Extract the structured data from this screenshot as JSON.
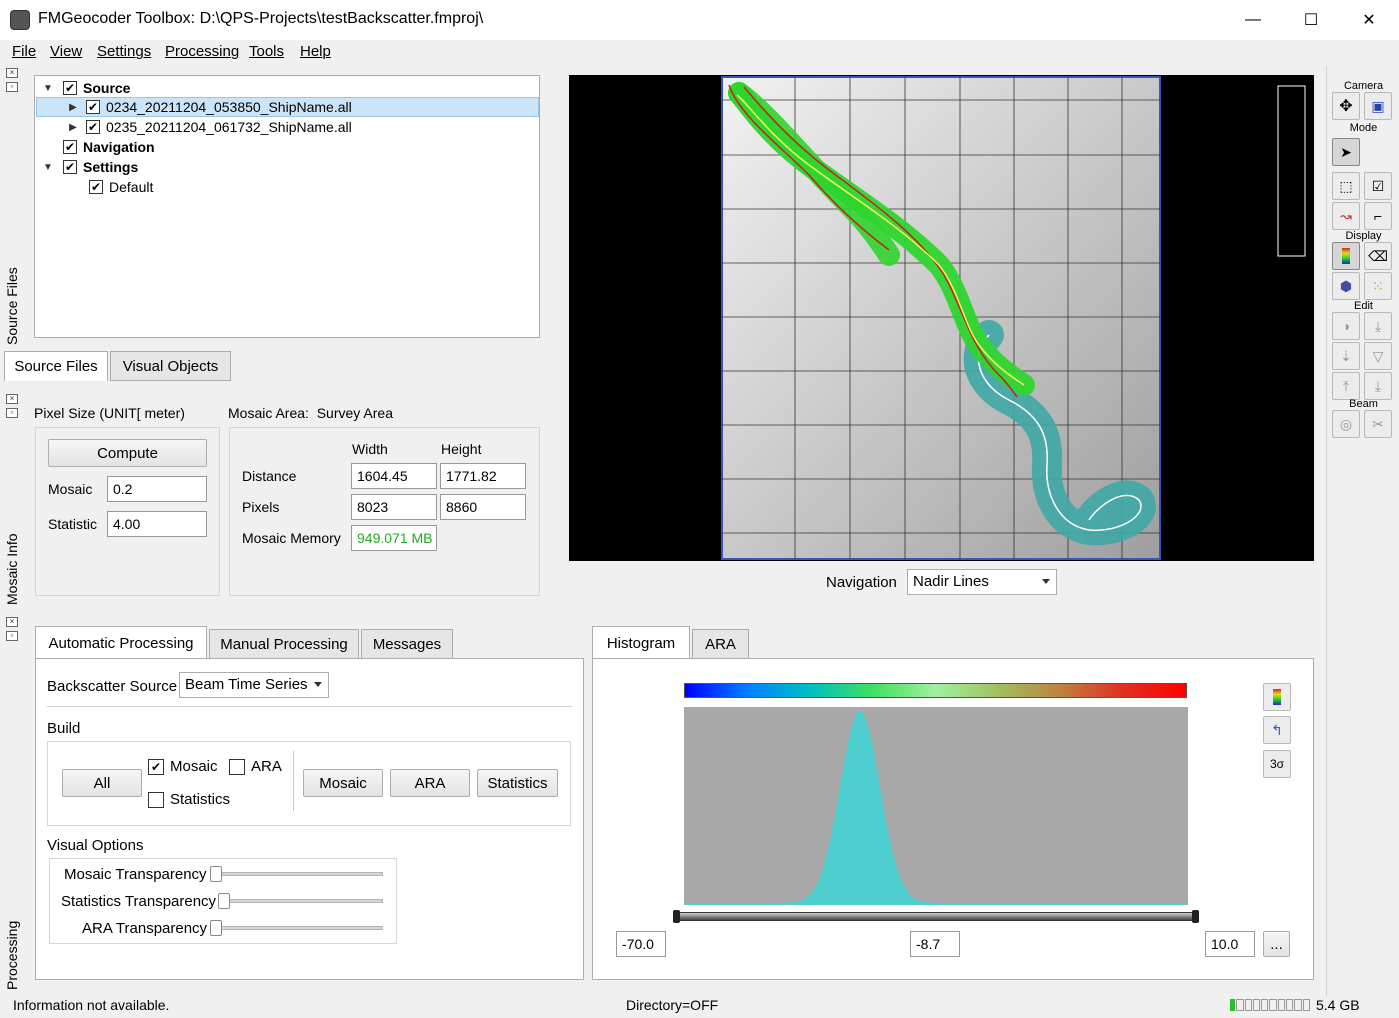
{
  "window": {
    "title": "FMGeocoder Toolbox: D:\\QPS-Projects\\testBackscatter.fmproj\\",
    "minimize": "—",
    "maximize": "☐",
    "close": "✕"
  },
  "menu": [
    "File",
    "View",
    "Settings",
    "Processing",
    "Tools",
    "Help"
  ],
  "docks": {
    "source_files": "Source Files",
    "mosaic_info": "Mosaic Info",
    "processing": "Processing"
  },
  "tree": {
    "source": "Source",
    "file1": "0234_20211204_053850_ShipName.all",
    "file2": "0235_20211204_061732_ShipName.all",
    "navigation": "Navigation",
    "settings": "Settings",
    "default": "Default"
  },
  "source_tabs": [
    "Source Files",
    "Visual Objects"
  ],
  "mosaic_info": {
    "pixel_size_label": "Pixel Size (UNIT[ meter)",
    "compute": "Compute",
    "mosaic_label": "Mosaic",
    "mosaic_value": "0.2",
    "statistic_label": "Statistic",
    "statistic_value": "4.00",
    "area_label": "Mosaic Area:",
    "area_value": "Survey Area",
    "width_header": "Width",
    "height_header": "Height",
    "distance_label": "Distance",
    "distance_width": "1604.45",
    "distance_height": "1771.82",
    "pixels_label": "Pixels",
    "pixels_width": "8023",
    "pixels_height": "8860",
    "memory_label": "Mosaic Memory",
    "memory_value": "949.071 MB",
    "memory_color": "#22aa22"
  },
  "navigation": {
    "label": "Navigation",
    "value": "Nadir Lines"
  },
  "toolbar": {
    "camera": "Camera",
    "mode": "Mode",
    "display": "Display",
    "edit": "Edit",
    "beam": "Beam"
  },
  "processing_tabs": [
    "Automatic Processing",
    "Manual Processing",
    "Messages"
  ],
  "auto": {
    "backscatter_source_label": "Backscatter Source",
    "backscatter_source_value": "Beam Time Series",
    "build_label": "Build",
    "all_button": "All",
    "cb_mosaic": "Mosaic",
    "cb_ara": "ARA",
    "cb_statistics": "Statistics",
    "btn_mosaic": "Mosaic",
    "btn_ara": "ARA",
    "btn_statistics": "Statistics",
    "visual_options_label": "Visual Options",
    "mosaic_transparency": "Mosaic Transparency",
    "statistics_transparency": "Statistics Transparency",
    "ara_transparency": "ARA Transparency"
  },
  "hist_tabs": [
    "Histogram",
    "ARA"
  ],
  "histogram": {
    "min": "-70.0",
    "mid": "-8.7",
    "max": "10.0",
    "more": "...",
    "sigma": "3σ",
    "fill_color": "#4fcfcf"
  },
  "status": {
    "info": "Information not available.",
    "directory": "Directory=OFF",
    "memory": "5.4 GB"
  }
}
